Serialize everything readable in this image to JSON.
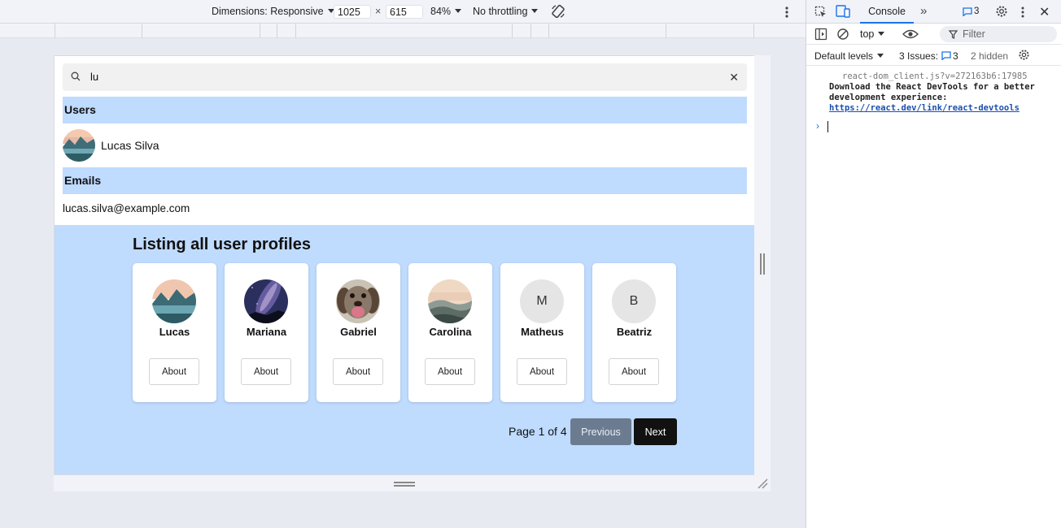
{
  "device_toolbar": {
    "dimensions_label": "Dimensions: Responsive",
    "width": "1025",
    "height": "615",
    "times": "×",
    "zoom": "84%",
    "throttling": "No throttling"
  },
  "page": {
    "search": {
      "value": "lu"
    },
    "users_header": "Users",
    "user_result": {
      "name": "Lucas Silva"
    },
    "emails_header": "Emails",
    "email_result": "lucas.silva@example.com",
    "listing": {
      "title": "Listing all user profiles",
      "profiles": [
        {
          "name": "Lucas",
          "avatar": "lake-mountains-photo",
          "about": "About"
        },
        {
          "name": "Mariana",
          "avatar": "milky-way-photo",
          "about": "About"
        },
        {
          "name": "Gabriel",
          "avatar": "dog-photo",
          "about": "About"
        },
        {
          "name": "Carolina",
          "avatar": "misty-hills-photo",
          "about": "About"
        },
        {
          "name": "Matheus",
          "initial": "M",
          "about": "About"
        },
        {
          "name": "Beatriz",
          "initial": "B",
          "about": "About"
        }
      ],
      "pager_text": "Page 1 of 4",
      "previous_label": "Previous",
      "next_label": "Next"
    }
  },
  "devtools": {
    "tab_console": "Console",
    "issues_badge": "3",
    "context": "top",
    "filter_placeholder": "Filter",
    "levels": "Default levels",
    "issues_label": "3 Issues:",
    "issues_count": "3",
    "hidden": "2 hidden",
    "message": {
      "source": "react-dom_client.js?v=272163b6:17985",
      "text": "Download the React DevTools for a better development experience: ",
      "link": "https://react.dev/link/react-devtools"
    }
  },
  "colors": {
    "accent_blue": "#bfdbfe",
    "next_button": "#111111",
    "previous_button": "#6b7c91",
    "devtools_active_tab": "#1a73e8"
  }
}
